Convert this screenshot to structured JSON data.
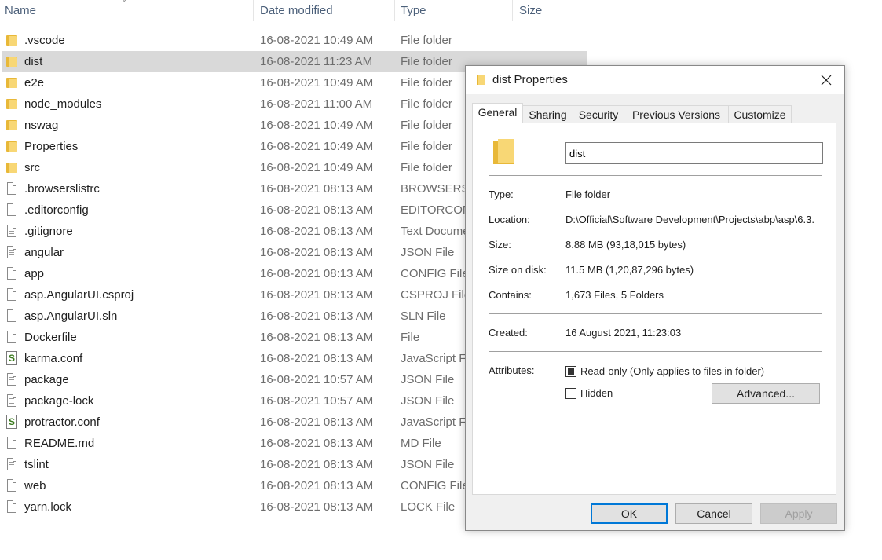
{
  "columns": {
    "name": "Name",
    "date_modified": "Date modified",
    "type": "Type",
    "size": "Size"
  },
  "files": [
    {
      "name": ".vscode",
      "date": "16-08-2021 10:49 AM",
      "type": "File folder",
      "icon": "folder"
    },
    {
      "name": "dist",
      "date": "16-08-2021 11:23 AM",
      "type": "File folder",
      "icon": "folder",
      "selected": true
    },
    {
      "name": "e2e",
      "date": "16-08-2021 10:49 AM",
      "type": "File folder",
      "icon": "folder"
    },
    {
      "name": "node_modules",
      "date": "16-08-2021 11:00 AM",
      "type": "File folder",
      "icon": "folder"
    },
    {
      "name": "nswag",
      "date": "16-08-2021 10:49 AM",
      "type": "File folder",
      "icon": "folder"
    },
    {
      "name": "Properties",
      "date": "16-08-2021 10:49 AM",
      "type": "File folder",
      "icon": "folder"
    },
    {
      "name": "src",
      "date": "16-08-2021 10:49 AM",
      "type": "File folder",
      "icon": "folder"
    },
    {
      "name": ".browserslistrc",
      "date": "16-08-2021 08:13 AM",
      "type": "BROWSERSL",
      "icon": "file"
    },
    {
      "name": ".editorconfig",
      "date": "16-08-2021 08:13 AM",
      "type": "EDITORCON",
      "icon": "file"
    },
    {
      "name": ".gitignore",
      "date": "16-08-2021 08:13 AM",
      "type": "Text Docume",
      "icon": "text-file"
    },
    {
      "name": "angular",
      "date": "16-08-2021 08:13 AM",
      "type": "JSON File",
      "icon": "text-file"
    },
    {
      "name": "app",
      "date": "16-08-2021 08:13 AM",
      "type": "CONFIG File",
      "icon": "file"
    },
    {
      "name": "asp.AngularUI.csproj",
      "date": "16-08-2021 08:13 AM",
      "type": "CSPROJ File",
      "icon": "file"
    },
    {
      "name": "asp.AngularUI.sln",
      "date": "16-08-2021 08:13 AM",
      "type": "SLN File",
      "icon": "file"
    },
    {
      "name": "Dockerfile",
      "date": "16-08-2021 08:13 AM",
      "type": "File",
      "icon": "file"
    },
    {
      "name": "karma.conf",
      "date": "16-08-2021 08:13 AM",
      "type": "JavaScript Fi",
      "icon": "js-file"
    },
    {
      "name": "package",
      "date": "16-08-2021 10:57 AM",
      "type": "JSON File",
      "icon": "text-file"
    },
    {
      "name": "package-lock",
      "date": "16-08-2021 10:57 AM",
      "type": "JSON File",
      "icon": "text-file"
    },
    {
      "name": "protractor.conf",
      "date": "16-08-2021 08:13 AM",
      "type": "JavaScript Fi",
      "icon": "js-file"
    },
    {
      "name": "README.md",
      "date": "16-08-2021 08:13 AM",
      "type": "MD File",
      "icon": "file"
    },
    {
      "name": "tslint",
      "date": "16-08-2021 08:13 AM",
      "type": "JSON File",
      "icon": "text-file"
    },
    {
      "name": "web",
      "date": "16-08-2021 08:13 AM",
      "type": "CONFIG File",
      "icon": "file"
    },
    {
      "name": "yarn.lock",
      "date": "16-08-2021 08:13 AM",
      "type": "LOCK File",
      "icon": "file"
    }
  ],
  "dialog": {
    "title": "dist Properties",
    "tabs": [
      "General",
      "Sharing",
      "Security",
      "Previous Versions",
      "Customize"
    ],
    "active_tab": "General",
    "folder_name": "dist",
    "type_label": "Type:",
    "type_value": "File folder",
    "location_label": "Location:",
    "location_value": "D:\\Official\\Software Development\\Projects\\abp\\asp\\6.3.",
    "size_label": "Size:",
    "size_value": "8.88 MB (93,18,015 bytes)",
    "size_on_disk_label": "Size on disk:",
    "size_on_disk_value": "11.5 MB (1,20,87,296 bytes)",
    "contains_label": "Contains:",
    "contains_value": "1,673 Files, 5 Folders",
    "created_label": "Created:",
    "created_value": "16 August 2021, 11:23:03",
    "attributes_label": "Attributes:",
    "readonly_label": "Read-only (Only applies to files in folder)",
    "readonly_checked": true,
    "hidden_label": "Hidden",
    "hidden_checked": false,
    "advanced_label": "Advanced...",
    "ok_label": "OK",
    "cancel_label": "Cancel",
    "apply_label": "Apply"
  }
}
